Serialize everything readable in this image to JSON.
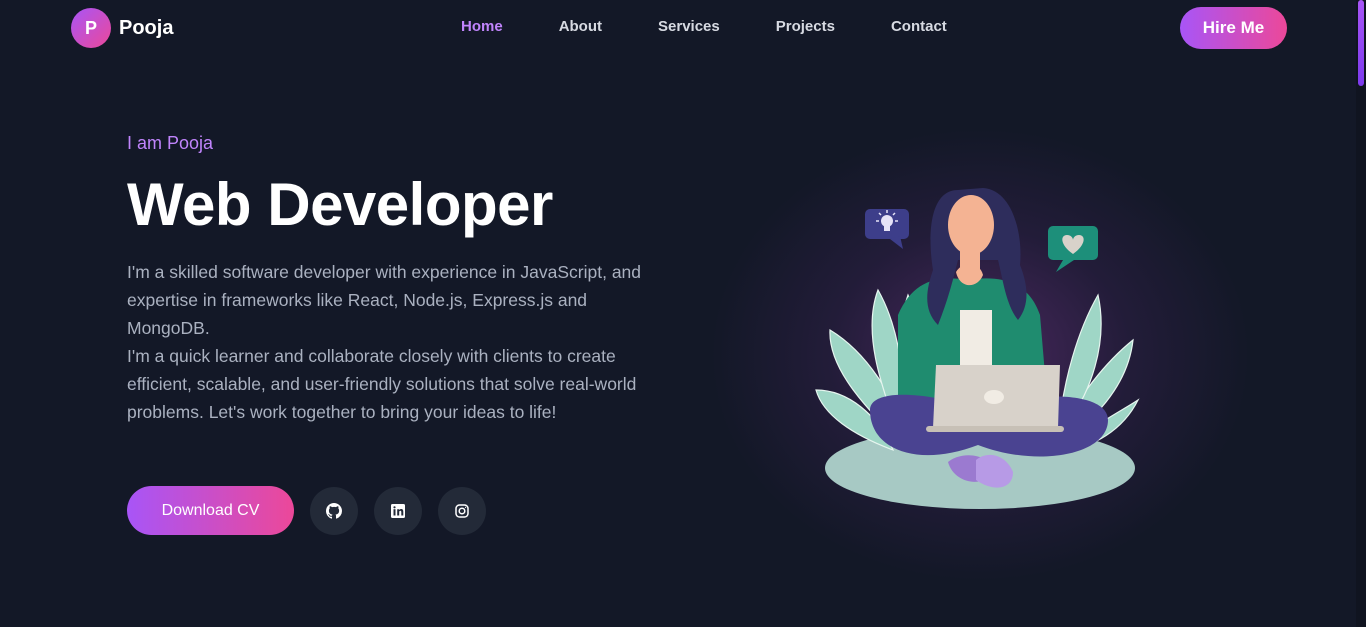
{
  "brand": {
    "initial": "P",
    "name": "Pooja"
  },
  "nav": {
    "links": [
      {
        "label": "Home",
        "active": true
      },
      {
        "label": "About",
        "active": false
      },
      {
        "label": "Services",
        "active": false
      },
      {
        "label": "Projects",
        "active": false
      },
      {
        "label": "Contact",
        "active": false
      }
    ],
    "cta_label": "Hire Me"
  },
  "hero": {
    "intro": "I am Pooja",
    "title": "Web Developer",
    "description_1": "I'm a skilled software developer with experience in JavaScript, and expertise in frameworks like React, Node.js, Express.js and MongoDB.",
    "description_2": "I'm a quick learner and collaborate closely with clients to create efficient, scalable, and user-friendly solutions that solve real-world problems. Let's work together to bring your ideas to life!",
    "download_label": "Download CV",
    "socials": [
      {
        "icon": "github-icon"
      },
      {
        "icon": "linkedin-icon"
      },
      {
        "icon": "instagram-icon"
      }
    ]
  },
  "colors": {
    "background": "#131827",
    "accent_purple": "#a855f7",
    "accent_pink": "#ec4899",
    "active_nav": "#c084fc",
    "body_text": "#aab1c0"
  }
}
